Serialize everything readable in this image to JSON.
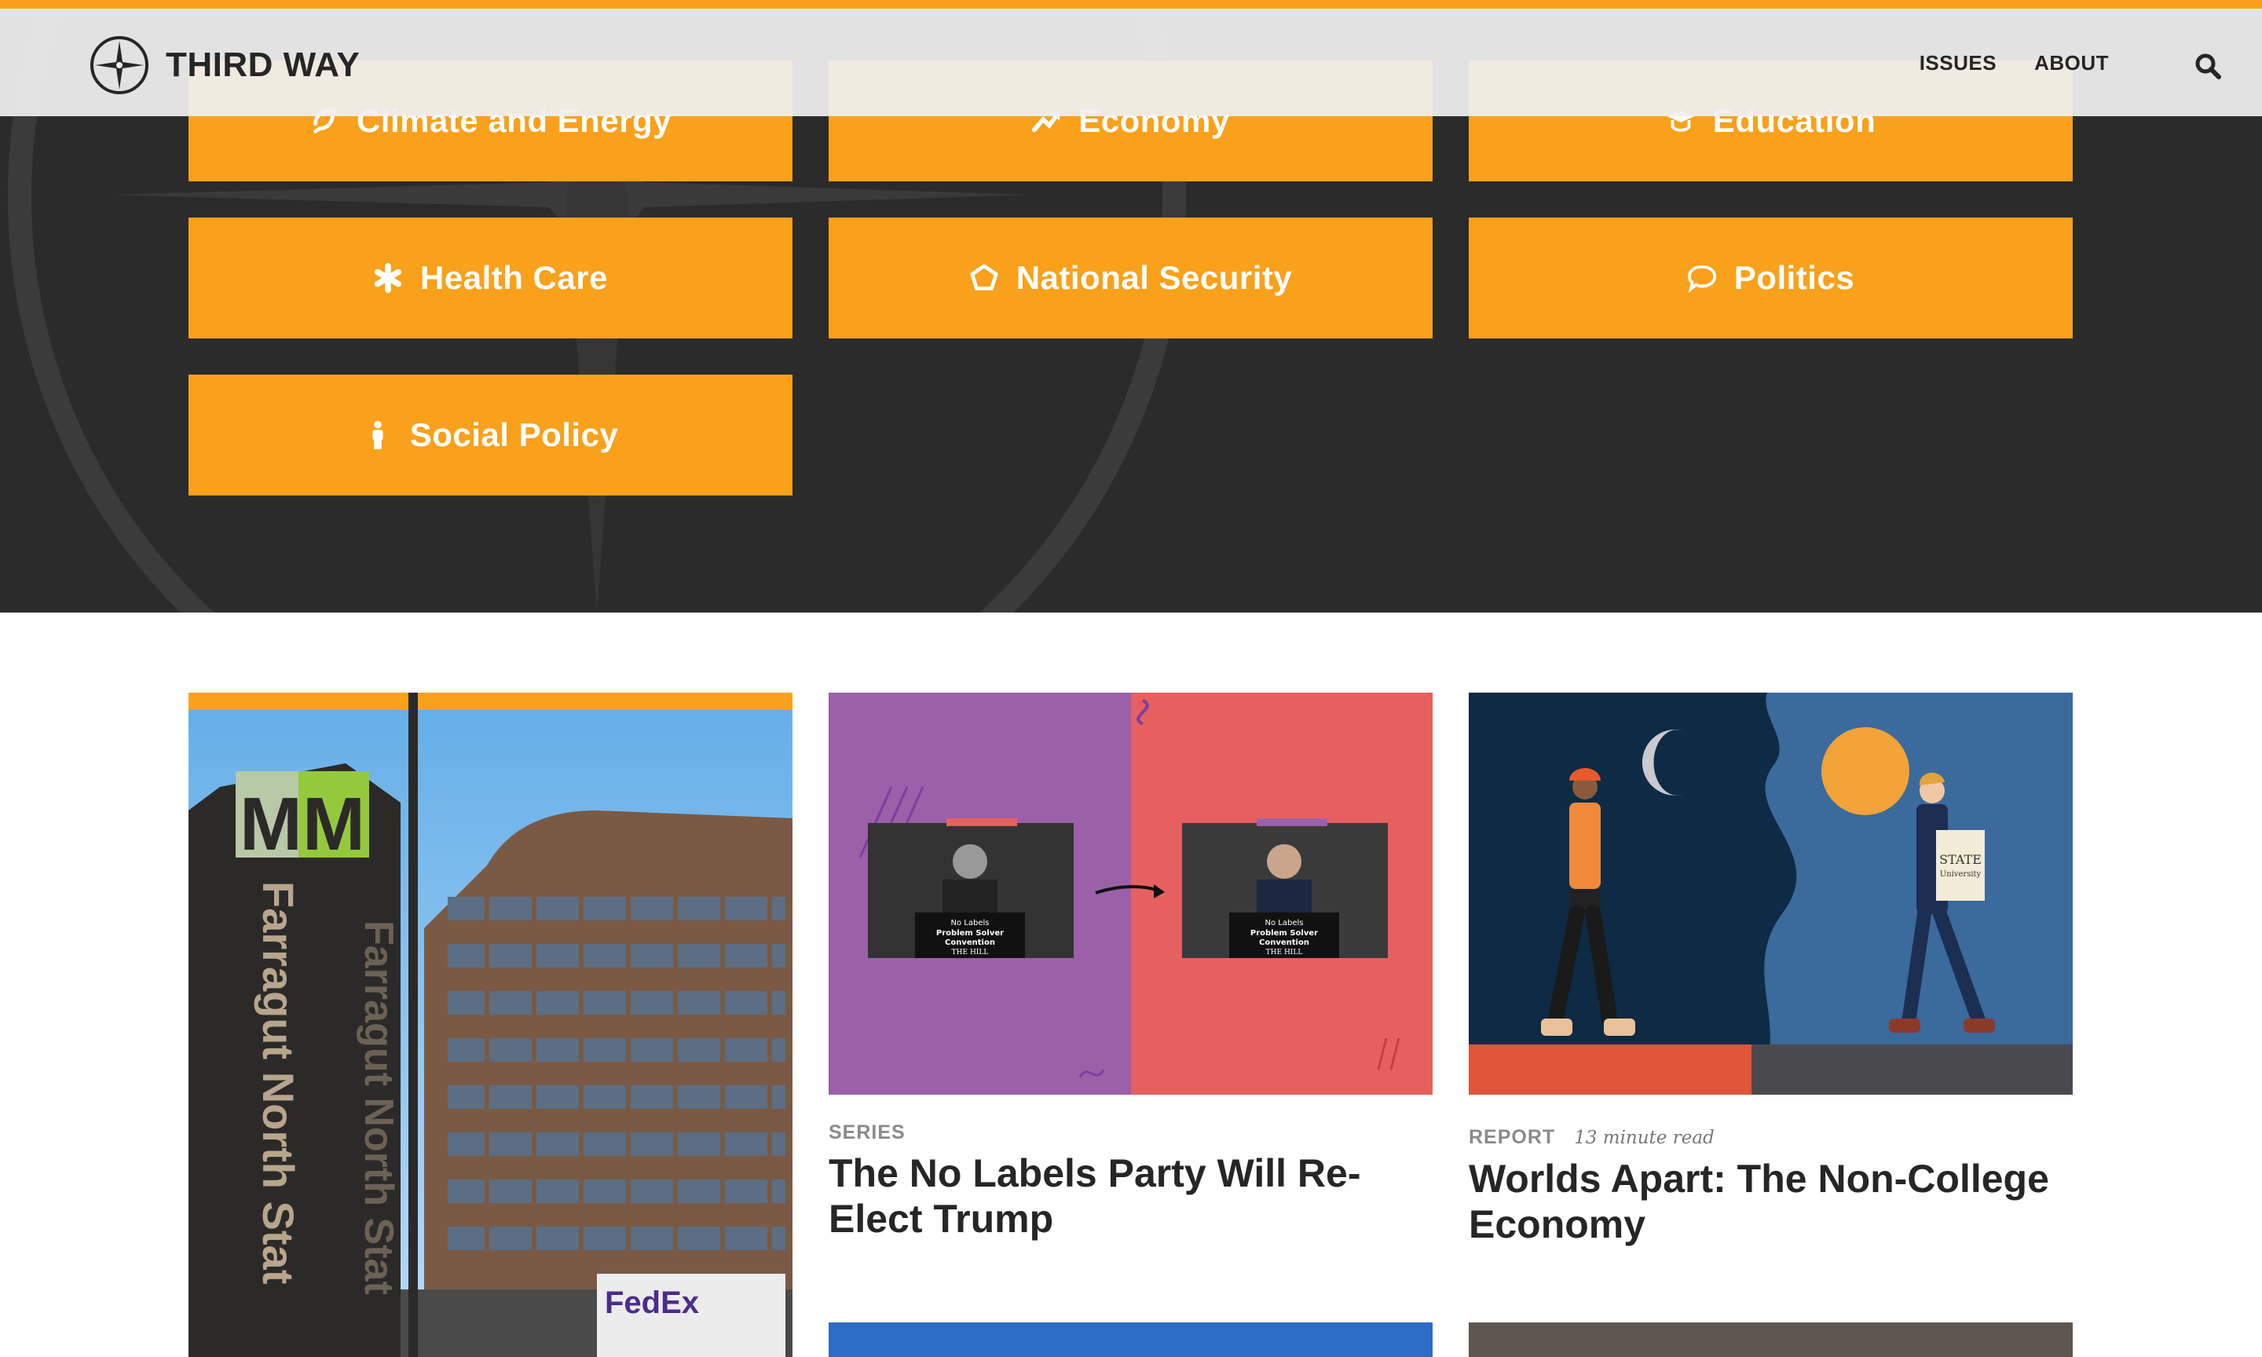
{
  "brand": {
    "name": "THIRD WAY",
    "accent_color": "#f7a01c",
    "button_color": "#f9a11b",
    "hero_color": "#2b2b2b",
    "text_color": "#262626"
  },
  "nav": {
    "items": [
      {
        "label": "ISSUES"
      },
      {
        "label": "ABOUT"
      }
    ],
    "search_icon": "search-icon"
  },
  "issues": [
    {
      "label": "Climate and Energy",
      "icon": "leaf-cycle-icon"
    },
    {
      "label": "Economy",
      "icon": "trend-up-icon"
    },
    {
      "label": "Education",
      "icon": "graduation-cap-icon"
    },
    {
      "label": "Health Care",
      "icon": "medical-asterisk-icon"
    },
    {
      "label": "National Security",
      "icon": "pentagon-icon"
    },
    {
      "label": "Politics",
      "icon": "speech-bubble-icon"
    },
    {
      "label": "Social Policy",
      "icon": "person-icon"
    }
  ],
  "cards": [
    {
      "image_alt": "Farragut North metro station sign",
      "sign_text": "Farragut North Stat",
      "sign_letter": "M",
      "truck_text": "FedEx"
    },
    {
      "eyebrow": "SERIES",
      "title": "The No Labels Party Will Re-Elect Trump",
      "podium_line1": "No Labels",
      "podium_line2": "Problem Solver",
      "podium_line3": "Convention",
      "podium_line4": "THE HILL"
    },
    {
      "eyebrow": "REPORT",
      "readtime": "13 minute read",
      "title": "Worlds Apart: The Non-College Economy",
      "bag_line1": "STATE",
      "bag_line2": "University"
    }
  ]
}
